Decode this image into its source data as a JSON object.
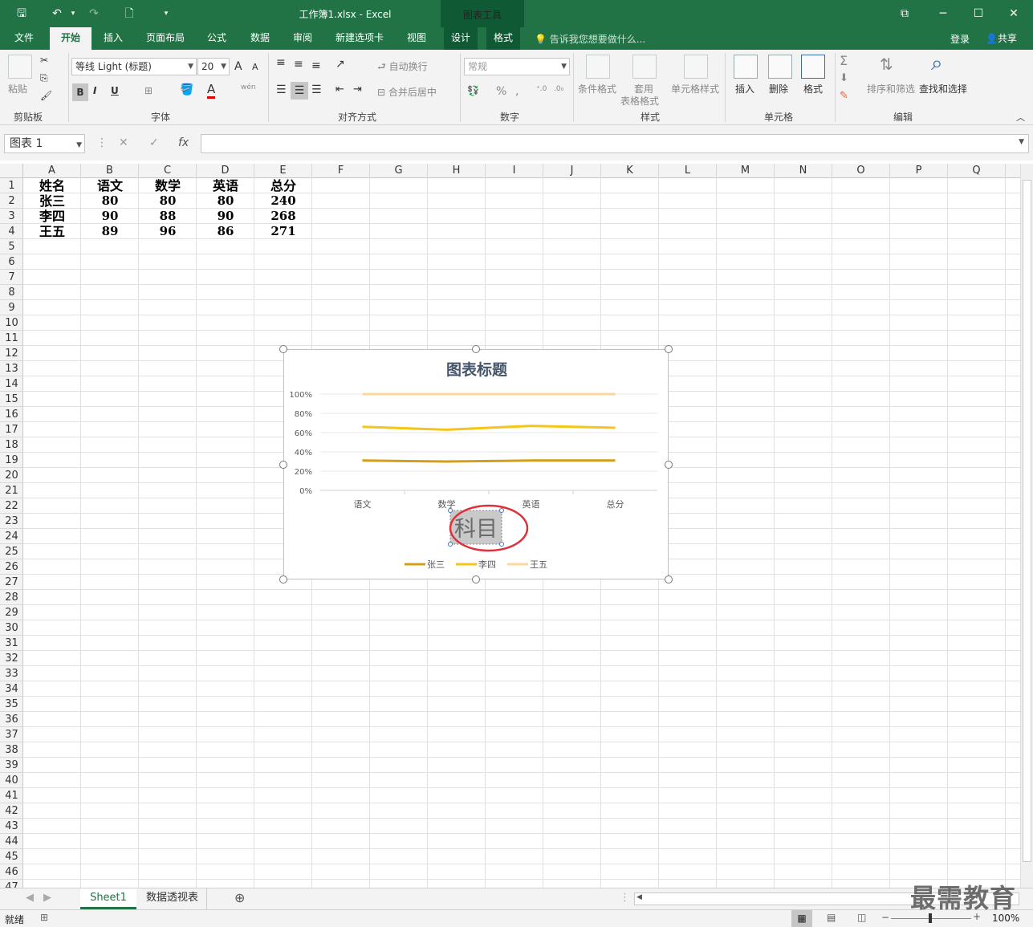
{
  "window": {
    "title": "工作簿1.xlsx - Excel",
    "context_tool": "图表工具"
  },
  "tabs": [
    "文件",
    "开始",
    "插入",
    "页面布局",
    "公式",
    "数据",
    "审阅",
    "新建选项卡",
    "视图",
    "设计",
    "格式"
  ],
  "tell_me": "告诉我您想要做什么...",
  "account": {
    "login": "登录",
    "share": "共享"
  },
  "ribbon": {
    "clipboard": {
      "label": "剪贴板",
      "paste": "粘贴"
    },
    "font": {
      "label": "字体",
      "name": "等线 Light (标题)",
      "size": "20",
      "bold": "B",
      "italic": "I",
      "underline": "U",
      "grow": "A",
      "shrink": "A",
      "phonetic": "wén"
    },
    "align": {
      "label": "对齐方式",
      "wrap": "自动换行",
      "merge": "合并后居中"
    },
    "number": {
      "label": "数字",
      "format": "常规",
      "percent": "%",
      "comma": ","
    },
    "styles": {
      "label": "样式",
      "conditional": "条件格式",
      "table_a": "套用",
      "table_b": "表格格式",
      "cell_styles": "单元格样式"
    },
    "cells": {
      "label": "单元格",
      "insert": "插入",
      "delete": "删除",
      "format": "格式"
    },
    "editing": {
      "label": "编辑",
      "sort": "排序和筛选",
      "find": "查找和选择",
      "sum": "Σ"
    }
  },
  "formula_bar": {
    "name_box": "图表 1",
    "fx": "fx",
    "cancel": "✕",
    "enter": "✓"
  },
  "columns": [
    "A",
    "B",
    "C",
    "D",
    "E",
    "F",
    "G",
    "H",
    "I",
    "J",
    "K",
    "L",
    "M",
    "N",
    "O",
    "P",
    "Q"
  ],
  "rows": [
    "1",
    "2",
    "3",
    "4",
    "5",
    "6",
    "7",
    "8",
    "9",
    "10",
    "11",
    "12",
    "13",
    "14",
    "15",
    "16",
    "17",
    "18",
    "19",
    "20",
    "21",
    "22",
    "23",
    "24",
    "25",
    "26",
    "27",
    "28",
    "29",
    "30",
    "31",
    "32",
    "33",
    "34",
    "35",
    "36",
    "37",
    "38",
    "39",
    "40",
    "41",
    "42",
    "43",
    "44",
    "45",
    "46",
    "47"
  ],
  "sheet": {
    "header": [
      "姓名",
      "语文",
      "数学",
      "英语",
      "总分"
    ],
    "rows": [
      [
        "张三",
        "80",
        "80",
        "80",
        "240"
      ],
      [
        "李四",
        "90",
        "88",
        "90",
        "268"
      ],
      [
        "王五",
        "89",
        "96",
        "86",
        "271"
      ]
    ]
  },
  "chart_data": {
    "type": "line",
    "title": "图表标题",
    "categories": [
      "语文",
      "数学",
      "英语",
      "总分"
    ],
    "xlabel": "科目",
    "ylim": [
      0,
      1
    ],
    "yticks": [
      "0%",
      "20%",
      "40%",
      "60%",
      "80%",
      "100%"
    ],
    "stacked_percent": true,
    "grid": true,
    "legend": "bottom",
    "series": [
      {
        "name": "张三",
        "values": [
          0.31,
          0.3,
          0.31,
          0.31
        ],
        "color": "#d4a017"
      },
      {
        "name": "李四",
        "values": [
          0.66,
          0.63,
          0.67,
          0.65
        ],
        "color": "#f5c518"
      },
      {
        "name": "王五",
        "values": [
          1.0,
          1.0,
          1.0,
          1.0
        ],
        "color": "#fbd79c"
      }
    ]
  },
  "sheet_tabs": [
    "Sheet1",
    "数据透视表"
  ],
  "status": {
    "ready": "就绪",
    "zoom": "100%"
  },
  "watermark": "最需教育"
}
